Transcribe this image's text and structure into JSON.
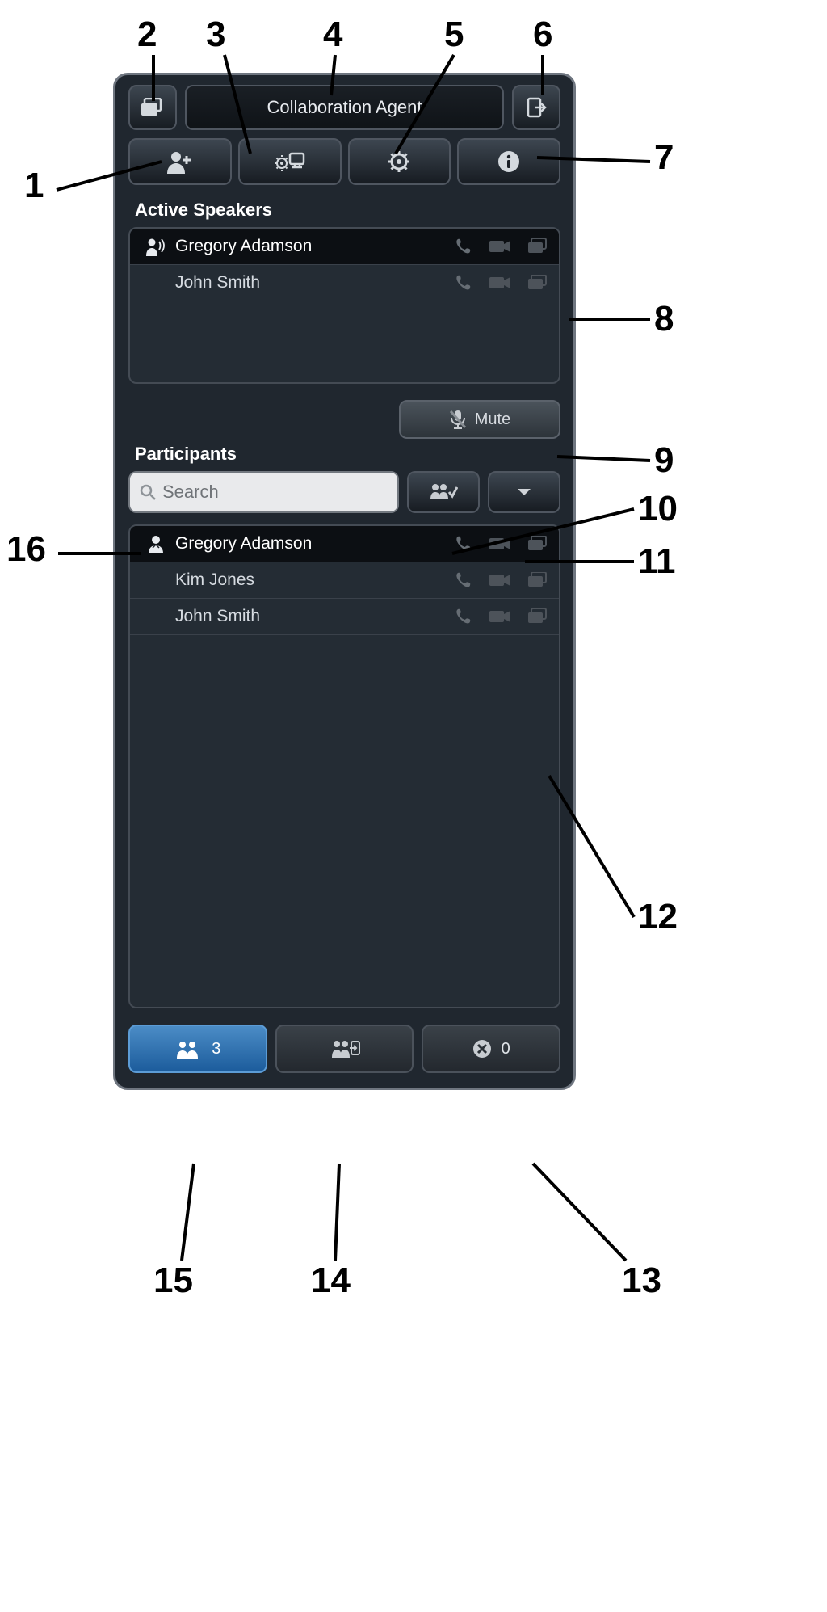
{
  "header": {
    "title": "Collaboration Agent"
  },
  "sections": {
    "active_speakers": "Active Speakers",
    "participants": "Participants"
  },
  "mute_label": "Mute",
  "search_placeholder": "Search",
  "active_speakers": [
    {
      "name": "Gregory Adamson",
      "speaking": true
    },
    {
      "name": "John Smith",
      "speaking": false
    }
  ],
  "participants": [
    {
      "name": "Gregory Adamson",
      "host": true
    },
    {
      "name": "Kim Jones",
      "host": false
    },
    {
      "name": "John Smith",
      "host": false
    }
  ],
  "bottom_tabs": {
    "participants_count": "3",
    "declined_count": "0"
  },
  "callouts": {
    "1": "1",
    "2": "2",
    "3": "3",
    "4": "4",
    "5": "5",
    "6": "6",
    "7": "7",
    "8": "8",
    "9": "9",
    "10": "10",
    "11": "11",
    "12": "12",
    "13": "13",
    "14": "14",
    "15": "15",
    "16": "16"
  }
}
